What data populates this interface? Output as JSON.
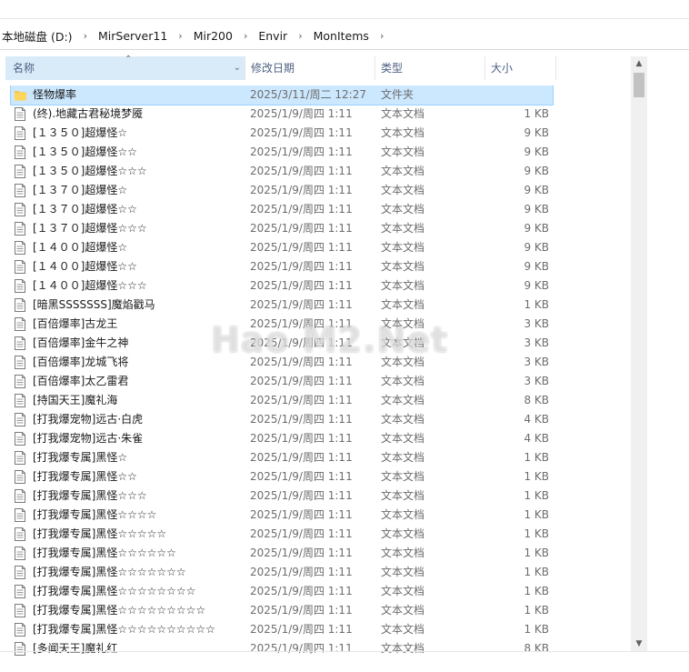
{
  "breadcrumb": [
    "本地磁盘 (D:)",
    "MirServer11",
    "Mir200",
    "Envir",
    "MonItems"
  ],
  "columns": {
    "name": "名称",
    "date": "修改日期",
    "type": "类型",
    "size": "大小"
  },
  "files": [
    {
      "name": "怪物爆率",
      "date": "2025/3/11/周二 12:27",
      "type": "文件夹",
      "size": "",
      "kind": "folder",
      "selected": true
    },
    {
      "name": "(终).地藏古君秘境梦魇",
      "date": "2025/1/9/周四 1:11",
      "type": "文本文档",
      "size": "1 KB",
      "kind": "text"
    },
    {
      "name": "[１３５０]超爆怪☆",
      "date": "2025/1/9/周四 1:11",
      "type": "文本文档",
      "size": "9 KB",
      "kind": "text"
    },
    {
      "name": "[１３５０]超爆怪☆☆",
      "date": "2025/1/9/周四 1:11",
      "type": "文本文档",
      "size": "9 KB",
      "kind": "text"
    },
    {
      "name": "[１３５０]超爆怪☆☆☆",
      "date": "2025/1/9/周四 1:11",
      "type": "文本文档",
      "size": "9 KB",
      "kind": "text"
    },
    {
      "name": "[１３７０]超爆怪☆",
      "date": "2025/1/9/周四 1:11",
      "type": "文本文档",
      "size": "9 KB",
      "kind": "text"
    },
    {
      "name": "[１３７０]超爆怪☆☆",
      "date": "2025/1/9/周四 1:11",
      "type": "文本文档",
      "size": "9 KB",
      "kind": "text"
    },
    {
      "name": "[１３７０]超爆怪☆☆☆",
      "date": "2025/1/9/周四 1:11",
      "type": "文本文档",
      "size": "9 KB",
      "kind": "text"
    },
    {
      "name": "[１４００]超爆怪☆",
      "date": "2025/1/9/周四 1:11",
      "type": "文本文档",
      "size": "9 KB",
      "kind": "text"
    },
    {
      "name": "[１４００]超爆怪☆☆",
      "date": "2025/1/9/周四 1:11",
      "type": "文本文档",
      "size": "9 KB",
      "kind": "text"
    },
    {
      "name": "[１４００]超爆怪☆☆☆",
      "date": "2025/1/9/周四 1:11",
      "type": "文本文档",
      "size": "9 KB",
      "kind": "text"
    },
    {
      "name": "[暗黑SSSSSSS]魔焰戳马",
      "date": "2025/1/9/周四 1:11",
      "type": "文本文档",
      "size": "1 KB",
      "kind": "text"
    },
    {
      "name": "[百倍爆率]古龙王",
      "date": "2025/1/9/周四 1:11",
      "type": "文本文档",
      "size": "3 KB",
      "kind": "text"
    },
    {
      "name": "[百倍爆率]金牛之神",
      "date": "2025/1/9/周四 1:11",
      "type": "文本文档",
      "size": "3 KB",
      "kind": "text"
    },
    {
      "name": "[百倍爆率]龙城飞将",
      "date": "2025/1/9/周四 1:11",
      "type": "文本文档",
      "size": "3 KB",
      "kind": "text"
    },
    {
      "name": "[百倍爆率]太乙雷君",
      "date": "2025/1/9/周四 1:11",
      "type": "文本文档",
      "size": "3 KB",
      "kind": "text"
    },
    {
      "name": "[持国天王]魔礼海",
      "date": "2025/1/9/周四 1:11",
      "type": "文本文档",
      "size": "8 KB",
      "kind": "text"
    },
    {
      "name": "[打我爆宠物]远古·白虎",
      "date": "2025/1/9/周四 1:11",
      "type": "文本文档",
      "size": "4 KB",
      "kind": "text"
    },
    {
      "name": "[打我爆宠物]远古·朱雀",
      "date": "2025/1/9/周四 1:11",
      "type": "文本文档",
      "size": "4 KB",
      "kind": "text"
    },
    {
      "name": "[打我爆专属]黑怪☆",
      "date": "2025/1/9/周四 1:11",
      "type": "文本文档",
      "size": "1 KB",
      "kind": "text"
    },
    {
      "name": "[打我爆专属]黑怪☆☆",
      "date": "2025/1/9/周四 1:11",
      "type": "文本文档",
      "size": "1 KB",
      "kind": "text"
    },
    {
      "name": "[打我爆专属]黑怪☆☆☆",
      "date": "2025/1/9/周四 1:11",
      "type": "文本文档",
      "size": "1 KB",
      "kind": "text"
    },
    {
      "name": "[打我爆专属]黑怪☆☆☆☆",
      "date": "2025/1/9/周四 1:11",
      "type": "文本文档",
      "size": "1 KB",
      "kind": "text"
    },
    {
      "name": "[打我爆专属]黑怪☆☆☆☆☆",
      "date": "2025/1/9/周四 1:11",
      "type": "文本文档",
      "size": "1 KB",
      "kind": "text"
    },
    {
      "name": "[打我爆专属]黑怪☆☆☆☆☆☆",
      "date": "2025/1/9/周四 1:11",
      "type": "文本文档",
      "size": "1 KB",
      "kind": "text"
    },
    {
      "name": "[打我爆专属]黑怪☆☆☆☆☆☆☆",
      "date": "2025/1/9/周四 1:11",
      "type": "文本文档",
      "size": "1 KB",
      "kind": "text"
    },
    {
      "name": "[打我爆专属]黑怪☆☆☆☆☆☆☆☆",
      "date": "2025/1/9/周四 1:11",
      "type": "文本文档",
      "size": "1 KB",
      "kind": "text"
    },
    {
      "name": "[打我爆专属]黑怪☆☆☆☆☆☆☆☆☆",
      "date": "2025/1/9/周四 1:11",
      "type": "文本文档",
      "size": "1 KB",
      "kind": "text"
    },
    {
      "name": "[打我爆专属]黑怪☆☆☆☆☆☆☆☆☆☆",
      "date": "2025/1/9/周四 1:11",
      "type": "文本文档",
      "size": "1 KB",
      "kind": "text"
    },
    {
      "name": "[多闻天王]魔礼红",
      "date": "2025/1/9/周四 1:11",
      "type": "文本文档",
      "size": "8 KB",
      "kind": "text"
    }
  ],
  "watermark": "Hao M2.Net",
  "colors": {
    "selection": "#cce8ff",
    "header_highlight": "#d9ebf9",
    "folder": "#f3c94b"
  }
}
